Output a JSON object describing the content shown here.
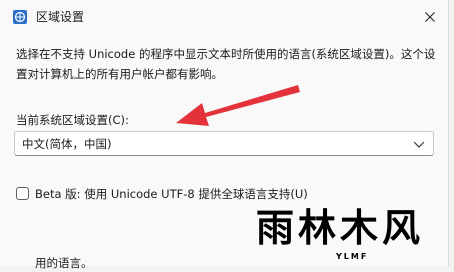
{
  "window": {
    "title": "区域设置"
  },
  "description": "选择在不支持 Unicode 的程序中显示文本时所使用的语言(系统区域设置)。这个设置对计算机上的所有用户帐户都有影响。",
  "current_setting": {
    "label": "当前系统区域设置(C):",
    "selected": "中文(简体，中国)"
  },
  "beta": {
    "label": "Beta 版: 使用 Unicode UTF-8 提供全球语言支持(U)",
    "checked": false
  },
  "cut_off_text": "用的语言。",
  "watermark": {
    "main": "雨林木风",
    "sub": "YLMF"
  },
  "colors": {
    "annotation_arrow": "#e3323a",
    "window_bg": "#f9f9f9"
  },
  "icons": {
    "app": "globe-settings-icon",
    "close": "close-icon",
    "dropdown": "chevron-down-icon"
  }
}
